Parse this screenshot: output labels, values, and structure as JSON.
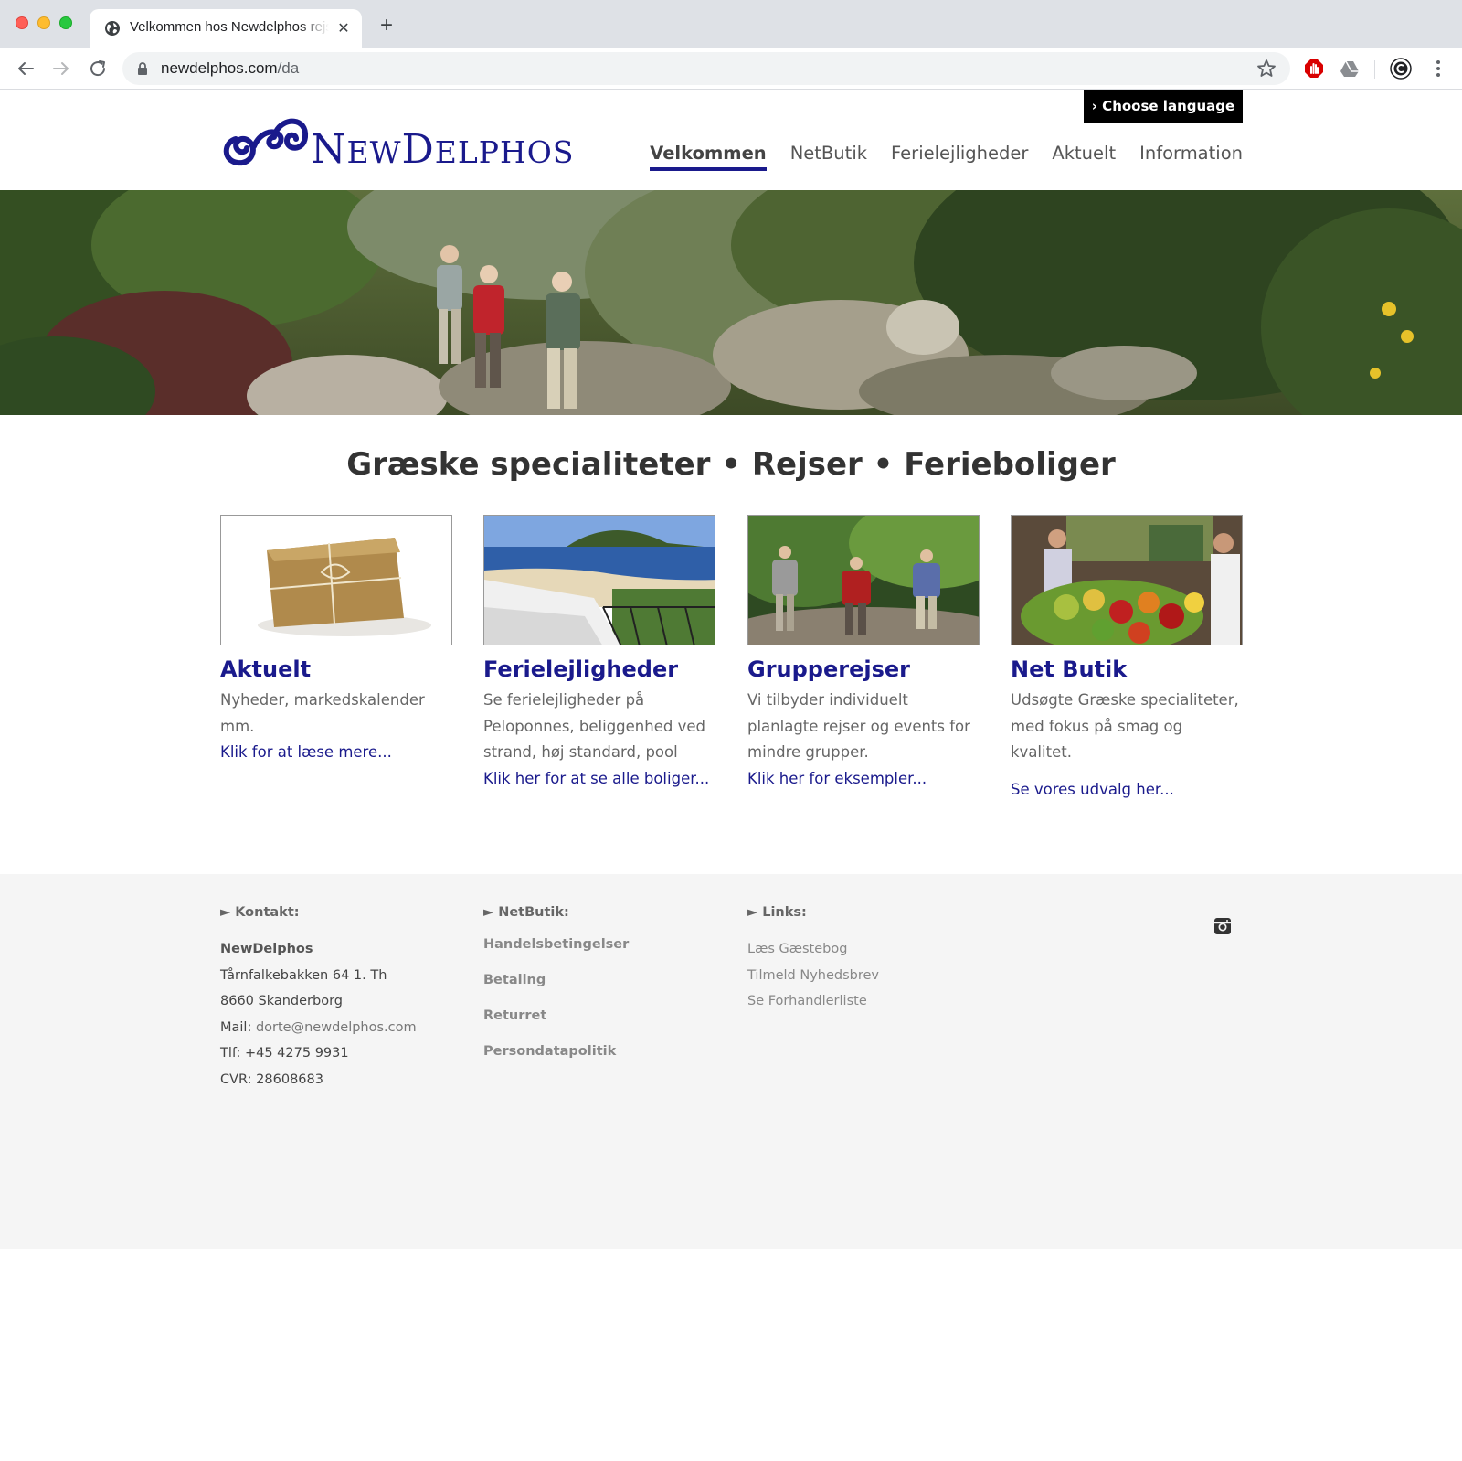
{
  "browser": {
    "tab_title": "Velkommen hos Newdelphos rejser",
    "url_host": "newdelphos.com",
    "url_path": "/da",
    "close_glyph": "✕",
    "new_tab_glyph": "+"
  },
  "header": {
    "logo_text_big_1": "N",
    "logo_text_small_1": "EW",
    "logo_text_big_2": "D",
    "logo_text_small_2": "ELPHOS",
    "language_button": "› Choose language",
    "nav": [
      {
        "label": "Velkommen",
        "active": true
      },
      {
        "label": "NetButik",
        "active": false
      },
      {
        "label": "Ferielejligheder",
        "active": false
      },
      {
        "label": "Aktuelt",
        "active": false
      },
      {
        "label": "Information",
        "active": false
      }
    ]
  },
  "main": {
    "headline": "Græske specialiteter • Rejser • Ferieboliger",
    "cards": [
      {
        "title": "Aktuelt",
        "text": "Nyheder, markedskalender mm.",
        "link": "Klik for at læse mere..."
      },
      {
        "title": "Ferielejligheder",
        "text": "Se ferielejligheder på Peloponnes, beliggenhed ved strand, høj standard, pool",
        "link": "Klik her for at se alle boliger..."
      },
      {
        "title": "Grupperejser",
        "text": "Vi tilbyder individuelt planlagte rejser og events for mindre grupper.",
        "link": "Klik her for eksempler..."
      },
      {
        "title": "Net Butik",
        "text": "Udsøgte Græske specialiteter, med fokus på smag og kvalitet.",
        "link": "Se vores udvalg her..."
      }
    ]
  },
  "footer": {
    "contact": {
      "heading": "► Kontakt:",
      "name": "NewDelphos",
      "street": "Tårnfalkebakken 64 1. Th",
      "city": "8660 Skanderborg",
      "mail_label": "Mail: ",
      "mail": "dorte@newdelphos.com",
      "phone": "Tlf: +45 4275 9931",
      "cvr": "CVR: 28608683"
    },
    "netbutik": {
      "heading": "► NetButik:",
      "links": [
        "Handelsbetingelser",
        "Betaling",
        "Returret",
        "Persondatapolitik"
      ]
    },
    "links": {
      "heading": "► Links:",
      "links": [
        "Læs Gæstebog",
        "Tilmeld Nyhedsbrev",
        "Se Forhandlerliste"
      ]
    }
  },
  "colors": {
    "brand_blue": "#1a1a8c",
    "footer_bg": "#f5f5f5",
    "language_button_bg": "#000000"
  },
  "icons": [
    "globe-icon",
    "back-arrow-icon",
    "forward-arrow-icon",
    "reload-icon",
    "lock-icon",
    "bookmark-star-icon",
    "adblock-extension-icon",
    "drive-extension-icon",
    "profile-avatar-icon",
    "kebab-menu-icon",
    "instagram-icon"
  ]
}
